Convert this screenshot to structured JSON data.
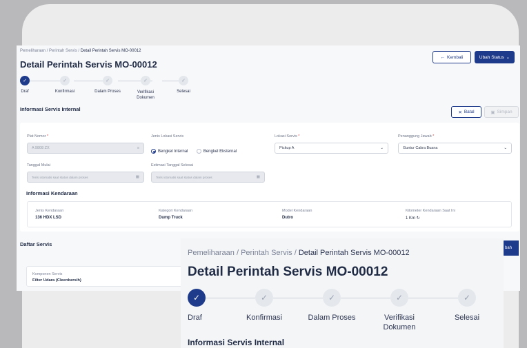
{
  "breadcrumb": [
    "Pemeliharaan",
    "Perintah Servis",
    "Detail Perintah Servis MO-00012"
  ],
  "page_title": "Detail Perintah Servis MO-00012",
  "buttons": {
    "back": "Kembali",
    "back_icon": "←",
    "status": "Ubah Status",
    "status_icon": "⌄",
    "cancel": "Batal",
    "cancel_icon": "✕",
    "save": "Simpan",
    "save_icon": "▣",
    "edit_partial": "bah"
  },
  "steps": [
    {
      "label": "Draf",
      "state": "done"
    },
    {
      "label": "Konfirmasi",
      "state": "todo"
    },
    {
      "label": "Dalam Proses",
      "state": "todo"
    },
    {
      "label": "Verifikasi Dokumen",
      "state": "todo"
    },
    {
      "label": "Selesai",
      "state": "todo"
    }
  ],
  "check_glyph": "✓",
  "section_internal": "Informasi Servis Internal",
  "form": {
    "plat_label": "Plat Nomor",
    "plat_value": "A 9808 ZX",
    "jenis_lokasi_label": "Jenis Lokasi Servis",
    "radio_internal": "Bengkel Internal",
    "radio_eksternal": "Bengkel Eksternal",
    "lokasi_label": "Lokasi Servis",
    "lokasi_value": "Pickup A",
    "penanggung_label": "Penanggung Jawab",
    "penanggung_value": "Guntur Cakra Buana",
    "tgl_mulai_label": "Tanggal Mulai",
    "tgl_mulai_placeholder": "Terisi otomatis saat status dalam proses",
    "estimasi_label": "Estimasi Tanggal Selesai",
    "estimasi_placeholder": "Terisi otomatis saat status dalam proses",
    "required_mark": "*",
    "menu_icon": "≡",
    "calendar_icon": "▦",
    "chevron_icon": "⌄"
  },
  "section_kendaraan": "Informasi Kendaraan",
  "kendaraan": [
    {
      "key": "Jenis Kendaraan",
      "value": "136 HDX LSD"
    },
    {
      "key": "Kategori Kendaraan",
      "value": "Dump Truck"
    },
    {
      "key": "Model Kendaraan",
      "value": "Dutro"
    },
    {
      "key": "Kilometer Kendaraan Saat Ini",
      "value": "1 Km"
    }
  ],
  "refresh_icon": "↻",
  "section_servis": "Daftar Servis",
  "servis_item": {
    "key": "Komponen Servis",
    "value": "Filter Udara (Cleenbersih)"
  },
  "colors": {
    "primary": "#1e3a8a",
    "required": "#d43d3d",
    "background": "#b9b9bb"
  }
}
